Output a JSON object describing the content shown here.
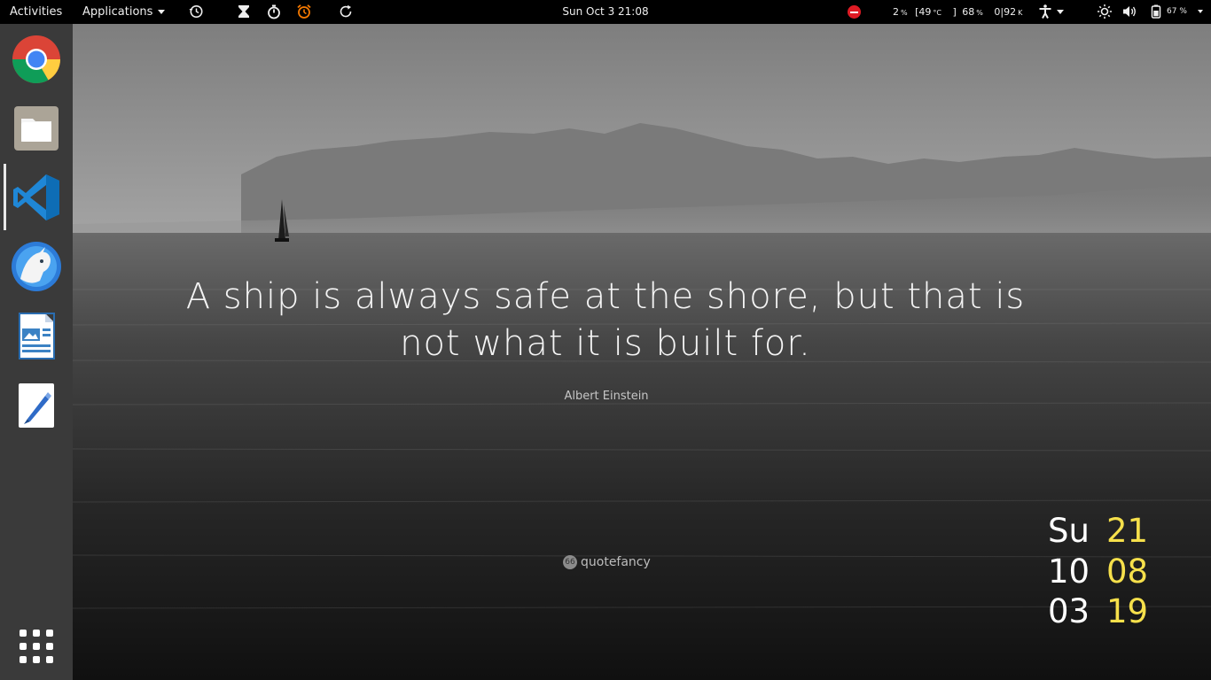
{
  "topbar": {
    "activities": "Activities",
    "applications": "Applications",
    "clock": "Sun Oct 3  21:08",
    "stats": {
      "cpu_value": "2",
      "cpu_unit": "%",
      "temp_value": "[49",
      "temp_unit": "°C",
      "mem_bracket": "]",
      "mem_value": "68",
      "mem_unit": "%",
      "net_value": "0|92",
      "net_unit": "K"
    },
    "battery": "67 %",
    "icons": [
      "history-icon",
      "hourglass-icon",
      "stopwatch-icon",
      "alarm-icon",
      "refresh-icon",
      "do-not-disturb-icon",
      "accessibility-icon",
      "brightness-icon",
      "volume-icon",
      "battery-icon"
    ]
  },
  "desktop": {
    "quote": "A ship is always safe at the shore, but that is not what it is built for.",
    "author": "Albert Einstein",
    "brand": "quotefancy",
    "brand_badge": "66"
  },
  "clock_widget": {
    "rows": [
      {
        "left": "Su",
        "right": "21"
      },
      {
        "left": "10",
        "right": "08"
      },
      {
        "left": "03",
        "right": "19"
      }
    ],
    "accent_color": "#f6e04b"
  },
  "dock": {
    "items": [
      "Google Chrome",
      "Files",
      "Visual Studio Code",
      "Mailspring",
      "LibreOffice Draw",
      "Text Editor"
    ],
    "active_index": 2
  }
}
